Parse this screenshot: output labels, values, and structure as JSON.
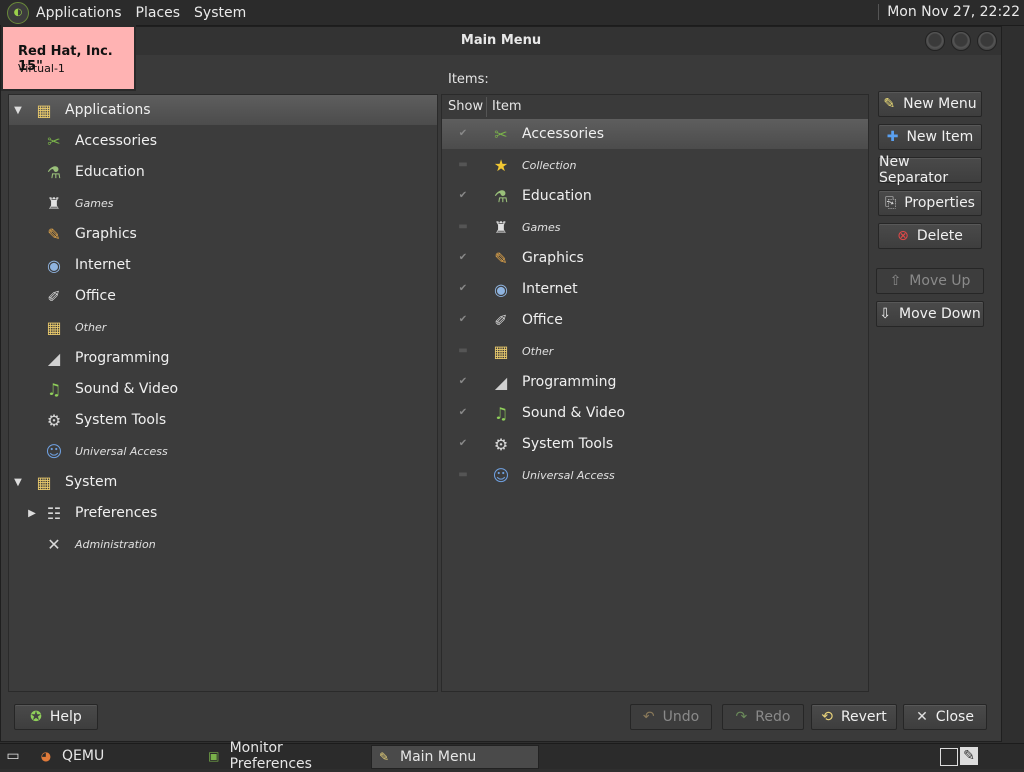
{
  "top_panel": {
    "menus": [
      "Applications",
      "Places",
      "System"
    ],
    "clock": "Mon Nov 27, 22:22"
  },
  "window": {
    "title": "Main Menu"
  },
  "tooltip": {
    "line1": "Red Hat, Inc. 15\"",
    "line2": "Virtual-1"
  },
  "tree": {
    "applications": "Applications",
    "children": [
      {
        "label": "Accessories",
        "icon": "accessories-icon",
        "italic": false
      },
      {
        "label": "Education",
        "icon": "education-icon",
        "italic": false
      },
      {
        "label": "Games",
        "icon": "games-icon",
        "italic": true
      },
      {
        "label": "Graphics",
        "icon": "graphics-icon",
        "italic": false
      },
      {
        "label": "Internet",
        "icon": "internet-icon",
        "italic": false
      },
      {
        "label": "Office",
        "icon": "office-icon",
        "italic": false
      },
      {
        "label": "Other",
        "icon": "other-icon",
        "italic": true
      },
      {
        "label": "Programming",
        "icon": "programming-icon",
        "italic": false
      },
      {
        "label": "Sound & Video",
        "icon": "sound-video-icon",
        "italic": false
      },
      {
        "label": "System Tools",
        "icon": "system-tools-icon",
        "italic": false
      },
      {
        "label": "Universal Access",
        "icon": "universal-access-icon",
        "italic": true
      }
    ],
    "system": "System",
    "system_children": [
      {
        "label": "Preferences",
        "italic": false
      },
      {
        "label": "Administration",
        "italic": true
      }
    ]
  },
  "items": {
    "label": "Items:",
    "col_show": "Show",
    "col_item": "Item",
    "rows": [
      {
        "label": "Accessories",
        "shown": true,
        "italic": false
      },
      {
        "label": "Collection",
        "shown": false,
        "italic": true
      },
      {
        "label": "Education",
        "shown": true,
        "italic": false
      },
      {
        "label": "Games",
        "shown": false,
        "italic": true
      },
      {
        "label": "Graphics",
        "shown": true,
        "italic": false
      },
      {
        "label": "Internet",
        "shown": true,
        "italic": false
      },
      {
        "label": "Office",
        "shown": true,
        "italic": false
      },
      {
        "label": "Other",
        "shown": false,
        "italic": true
      },
      {
        "label": "Programming",
        "shown": true,
        "italic": false
      },
      {
        "label": "Sound & Video",
        "shown": true,
        "italic": false
      },
      {
        "label": "System Tools",
        "shown": true,
        "italic": false
      },
      {
        "label": "Universal Access",
        "shown": false,
        "italic": true
      }
    ]
  },
  "buttons": {
    "new_menu": "New Menu",
    "new_item": "New Item",
    "new_separator": "New Separator",
    "properties": "Properties",
    "delete": "Delete",
    "move_up": "Move Up",
    "move_down": "Move Down",
    "help": "Help",
    "undo": "Undo",
    "redo": "Redo",
    "revert": "Revert",
    "close": "Close"
  },
  "taskbar": {
    "tasks": [
      "QEMU",
      "Monitor Preferences",
      "Main Menu"
    ]
  }
}
